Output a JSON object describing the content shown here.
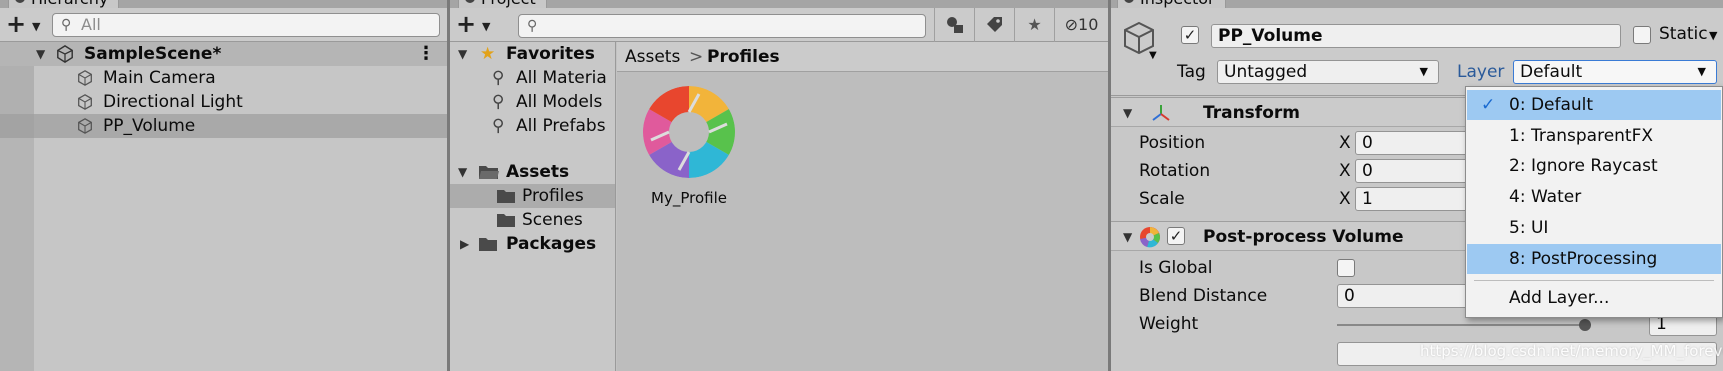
{
  "hierarchy": {
    "tab_title": "Hierarchy",
    "search_placeholder": "All",
    "scene_name": "SampleScene*",
    "items": [
      {
        "label": "Main Camera"
      },
      {
        "label": "Directional Light"
      },
      {
        "label": "PP_Volume"
      }
    ]
  },
  "project": {
    "tab_title": "Project",
    "favorites": {
      "label": "Favorites",
      "items": [
        "All Materia",
        "All Models",
        "All Prefabs"
      ]
    },
    "assets": {
      "label": "Assets",
      "items": [
        "Profiles",
        "Scenes"
      ]
    },
    "packages_label": "Packages",
    "breadcrumb": {
      "root": "Assets",
      "separator": ">",
      "current": "Profiles"
    },
    "asset_items": [
      {
        "label": "My_Profile"
      }
    ],
    "hidden_count": "10"
  },
  "inspector": {
    "tab_title": "Inspector",
    "object_name": "PP_Volume",
    "static_label": "Static",
    "tag_label": "Tag",
    "tag_value": "Untagged",
    "layer_label": "Layer",
    "layer_value": "Default",
    "transform": {
      "title": "Transform",
      "rows": [
        {
          "label": "Position",
          "axis": "X",
          "value": "0"
        },
        {
          "label": "Rotation",
          "axis": "X",
          "value": "0"
        },
        {
          "label": "Scale",
          "axis": "X",
          "value": "1"
        }
      ]
    },
    "ppvolume": {
      "title": "Post-process Volume",
      "is_global_label": "Is Global",
      "blend_distance_label": "Blend Distance",
      "blend_distance_value": "0",
      "weight_label": "Weight",
      "weight_value": "1"
    }
  },
  "layer_menu": {
    "items": [
      {
        "label": "0: Default",
        "checked": true
      },
      {
        "label": "1: TransparentFX"
      },
      {
        "label": "2: Ignore Raycast"
      },
      {
        "label": "4: Water"
      },
      {
        "label": "5: UI"
      },
      {
        "label": "8: PostProcessing",
        "highlighted": true
      }
    ],
    "add_label": "Add Layer..."
  },
  "watermark": "https://blog.csdn.net/memory_MM_forever",
  "colors": {
    "panel_bg": "#c8c8c8",
    "selection": "#9dc9f2",
    "layer_label_blue": "#2a5a9a"
  }
}
